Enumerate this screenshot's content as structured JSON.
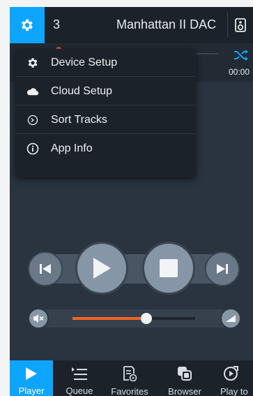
{
  "topbar": {
    "zone_count": "3",
    "device_name": "Manhattan II DAC"
  },
  "strip": {
    "time_right": "00:00"
  },
  "menu": {
    "items": [
      {
        "label": "Device Setup",
        "icon": "gear-icon"
      },
      {
        "label": "Cloud Setup",
        "icon": "cloud-icon"
      },
      {
        "label": "Sort Tracks",
        "icon": "sort-clock-icon"
      },
      {
        "label": "App Info",
        "icon": "info-icon"
      }
    ]
  },
  "volume": {
    "level": 0.6
  },
  "nav": {
    "items": [
      {
        "label": "Player",
        "icon": "play-icon",
        "active": true
      },
      {
        "label": "Queue",
        "icon": "queue-icon"
      },
      {
        "label": "Favorites",
        "icon": "favorites-icon"
      },
      {
        "label": "Browser",
        "icon": "browser-icon"
      },
      {
        "label": "Play to",
        "icon": "play-to-icon"
      }
    ]
  },
  "colors": {
    "accent": "#0ea5ff",
    "volume_fill": "#f26522",
    "background": "#2a3440",
    "bar": "#1c2229"
  }
}
